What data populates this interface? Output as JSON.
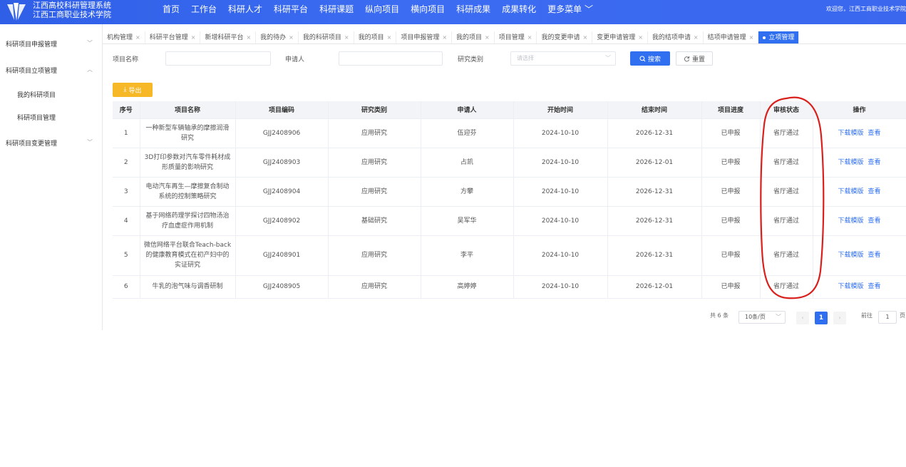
{
  "header": {
    "system_name": "江西高校科研管理系统",
    "school_name": "江西工商职业技术学院",
    "nav": [
      "首页",
      "工作台",
      "科研人才",
      "科研平台",
      "科研课题",
      "纵向项目",
      "横向项目",
      "科研成果",
      "成果转化",
      "更多菜单 ﹀"
    ],
    "welcome": "欢迎您，江西工商职业技术学院"
  },
  "sidebar": {
    "groups": [
      {
        "label": "科研项目申报管理",
        "arrow": "﹀"
      },
      {
        "label": "科研项目立项管理",
        "arrow": "︿"
      },
      {
        "label": "科研项目变更管理",
        "arrow": "﹀"
      }
    ],
    "subitems": [
      "我的科研项目",
      "科研项目管理"
    ]
  },
  "tabs": [
    {
      "label": "机构管理"
    },
    {
      "label": "科研平台管理"
    },
    {
      "label": "新增科研平台"
    },
    {
      "label": "我的待办"
    },
    {
      "label": "我的科研项目"
    },
    {
      "label": "我的项目"
    },
    {
      "label": "项目申报管理"
    },
    {
      "label": "我的项目"
    },
    {
      "label": "项目管理"
    },
    {
      "label": "我的变更申请"
    },
    {
      "label": "变更申请管理"
    },
    {
      "label": "我的结项申请"
    },
    {
      "label": "结项申请管理"
    },
    {
      "label": "立项管理",
      "active": true
    }
  ],
  "filters": {
    "project_name_label": "项目名称",
    "applicant_label": "申请人",
    "category_label": "研究类别",
    "category_placeholder": "请选择",
    "search_label": "搜索",
    "reset_label": "重置"
  },
  "export_label": "导出",
  "table": {
    "headers": [
      "序号",
      "项目名称",
      "项目编码",
      "研究类别",
      "申请人",
      "开始时间",
      "结束时间",
      "项目进度",
      "审核状态",
      "操作"
    ],
    "ops": [
      "下载模版",
      "查看"
    ],
    "rows": [
      {
        "no": "1",
        "name": "一种新型车辆轴承的摩擦润滑研究",
        "code": "GJJ2408906",
        "category": "应用研究",
        "applicant": "伍迎芬",
        "start": "2024-10-10",
        "end": "2026-12-31",
        "progress": "已申报",
        "status": "省厅通过"
      },
      {
        "no": "2",
        "name": "3D打印参数对汽车零件耗材成形质量的影响研究",
        "code": "GJJ2408903",
        "category": "应用研究",
        "applicant": "占凯",
        "start": "2024-10-10",
        "end": "2026-12-01",
        "progress": "已申报",
        "status": "省厅通过"
      },
      {
        "no": "3",
        "name": "电动汽车再生—摩擦复合制动系统的控制策略研究",
        "code": "GJJ2408904",
        "category": "应用研究",
        "applicant": "方攀",
        "start": "2024-10-10",
        "end": "2026-12-31",
        "progress": "已申报",
        "status": "省厅通过"
      },
      {
        "no": "4",
        "name": "基于网络药理学探讨四物汤治疗血虚症作用机制",
        "code": "GJJ2408902",
        "category": "基础研究",
        "applicant": "吴军华",
        "start": "2024-10-10",
        "end": "2026-12-31",
        "progress": "已申报",
        "status": "省厅通过"
      },
      {
        "no": "5",
        "name": "微信网络平台联合Teach-back的健康教育模式在初产妇中的实证研究",
        "code": "GJJ2408901",
        "category": "应用研究",
        "applicant": "李平",
        "start": "2024-10-10",
        "end": "2026-12-31",
        "progress": "已申报",
        "status": "省厅通过"
      },
      {
        "no": "6",
        "name": "牛乳的泡气味与调香研制",
        "code": "GJJ2408905",
        "category": "应用研究",
        "applicant": "高婷婷",
        "start": "2024-10-10",
        "end": "2026-12-01",
        "progress": "已申报",
        "status": "省厅通过"
      }
    ]
  },
  "pagination": {
    "total": "共 6 条",
    "page_size": "10条/页",
    "prev": "‹",
    "current": "1",
    "next": "›",
    "goto_label": "前往",
    "goto_value": "1",
    "page_suffix": "页"
  },
  "colors": {
    "primary": "#2f6ff0",
    "export": "#f7b827",
    "annotation": "#d9201c"
  }
}
